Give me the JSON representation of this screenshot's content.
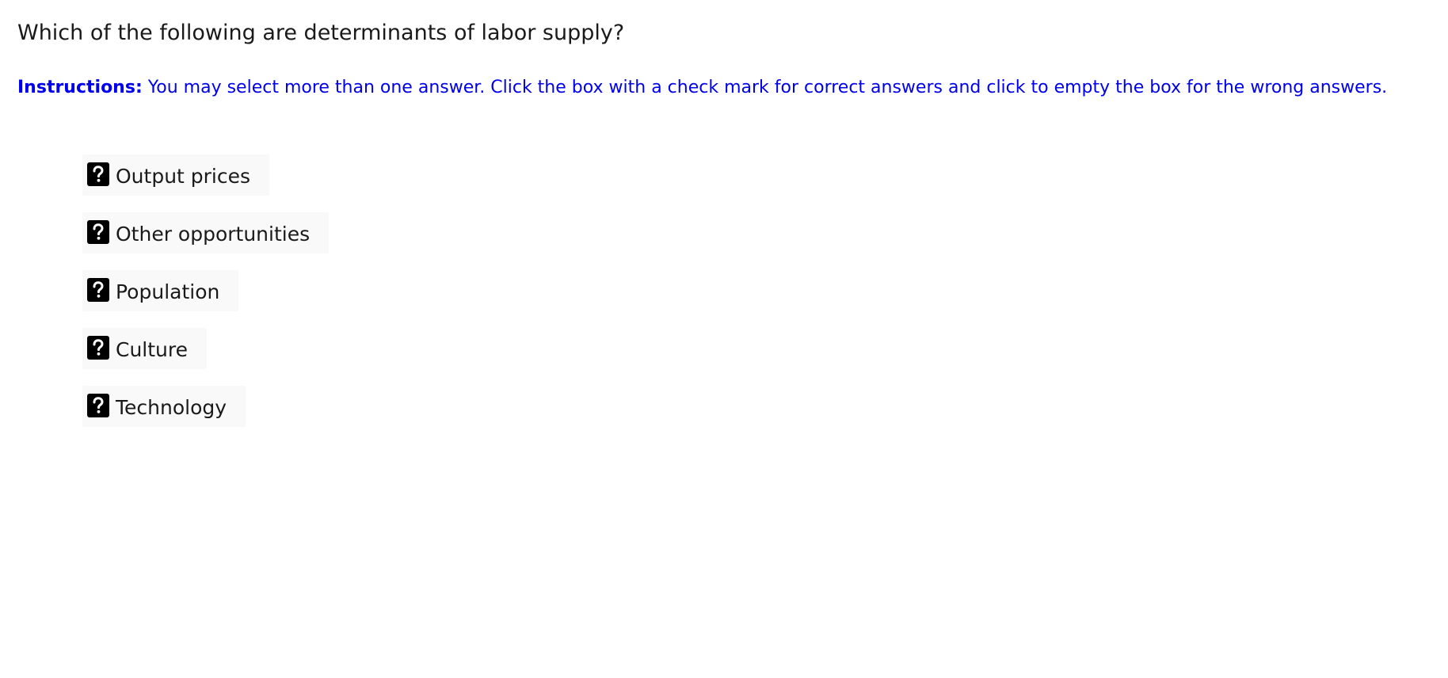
{
  "question": {
    "text": "Which of the following are determinants of labor supply?"
  },
  "instructions": {
    "lead": "Instructions:",
    "text": " You may select more than one answer. Click the box with a check mark for correct answers and click to empty the box for the wrong answers."
  },
  "options": [
    {
      "label": "Output prices",
      "state_icon": "question-mark-icon"
    },
    {
      "label": "Other opportunities",
      "state_icon": "question-mark-icon"
    },
    {
      "label": "Population",
      "state_icon": "question-mark-icon"
    },
    {
      "label": "Culture",
      "state_icon": "question-mark-icon"
    },
    {
      "label": "Technology",
      "state_icon": "question-mark-icon"
    }
  ],
  "colors": {
    "instruction_text": "#0000ee",
    "option_background": "#f9f9f9",
    "state_box": "#000000"
  }
}
